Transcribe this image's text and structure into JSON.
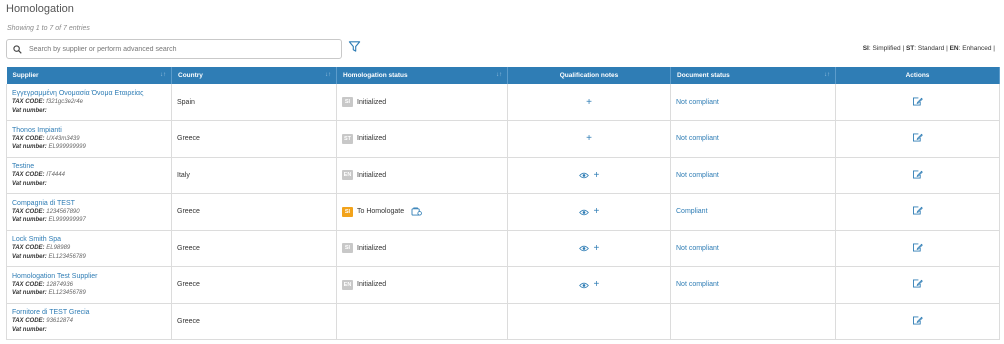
{
  "page": {
    "title": "Homologation",
    "showing": "Showing 1 to 7 of 7 entries"
  },
  "search": {
    "placeholder": "Search by supplier or perform advanced search"
  },
  "legend": {
    "si_key": "SI",
    "si_label": ": Simplified |",
    "st_key": "ST",
    "st_label": ": Standard |",
    "en_key": "EN",
    "en_label": ": Enhanced |"
  },
  "columns": {
    "supplier": "Supplier",
    "country": "Country",
    "status": "Homologation status",
    "notes": "Qualification notes",
    "doc_status": "Document status",
    "actions": "Actions",
    "sort_glyph": "↓↑"
  },
  "labels": {
    "tax_code": "TAX CODE:",
    "vat_number": "Vat number:",
    "plus": "+"
  },
  "rows": [
    {
      "name": "Εγγεγραμμένη Ονομασία Όνομα Εταιρείας",
      "tax": "f321gc3e2r4e",
      "vat": "",
      "country": "Spain",
      "badge": "SI",
      "status": "Initialized",
      "eye": false,
      "doc": "Not compliant"
    },
    {
      "name": "Thonos Impianti",
      "tax": "UX43m3439",
      "vat": "EL999999999",
      "country": "Greece",
      "badge": "ST",
      "status": "Initialized",
      "eye": false,
      "doc": "Not compliant"
    },
    {
      "name": "Testine",
      "tax": "IT4444",
      "vat": "",
      "country": "Italy",
      "badge": "EN",
      "status": "Initialized",
      "eye": true,
      "doc": "Not compliant"
    },
    {
      "name": "Compagnia di TEST",
      "tax": "1234567890",
      "vat": "EL999999997",
      "country": "Greece",
      "badge": "SI",
      "status": "To Homologate",
      "eye": true,
      "doc": "Compliant"
    },
    {
      "name": "Lock Smith Spa",
      "tax": "EL98989",
      "vat": "EL123456789",
      "country": "Greece",
      "badge": "SI",
      "status": "Initialized",
      "eye": true,
      "doc": "Not compliant"
    },
    {
      "name": "Homologation Test Supplier",
      "tax": "12874936",
      "vat": "EL123456789",
      "country": "Greece",
      "badge": "EN",
      "status": "Initialized",
      "eye": true,
      "doc": "Not compliant"
    },
    {
      "name": "Fornitore di TEST Grecia",
      "tax": "93612874",
      "vat": "",
      "country": "Greece",
      "badge": "",
      "status": "",
      "eye": false,
      "doc": ""
    }
  ],
  "colors": {
    "header_bg": "#2f7db5",
    "link": "#2f7db5",
    "badge_gray": "#c8c8c8",
    "badge_orange": "#f2a31b"
  }
}
